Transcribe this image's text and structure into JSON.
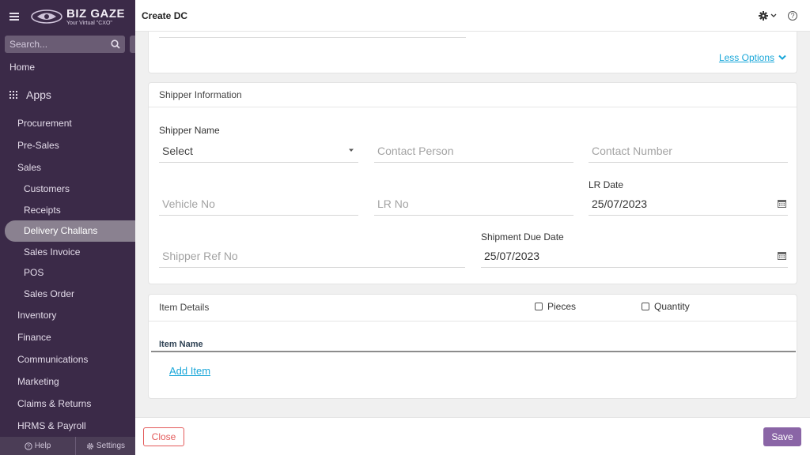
{
  "sidebar": {
    "logo": {
      "name": "BIZ GAZE",
      "tagline": "Your Virtual \"CXO\""
    },
    "search": {
      "placeholder": "Search..."
    },
    "home": "Home",
    "apps": "Apps",
    "items": [
      {
        "label": "Procurement"
      },
      {
        "label": "Pre-Sales"
      },
      {
        "label": "Sales"
      },
      {
        "label": "Customers"
      },
      {
        "label": "Receipts"
      },
      {
        "label": "Delivery Challans"
      },
      {
        "label": "Sales Invoice"
      },
      {
        "label": "POS"
      },
      {
        "label": "Sales Order"
      },
      {
        "label": "Inventory"
      },
      {
        "label": "Finance"
      },
      {
        "label": "Communications"
      },
      {
        "label": "Marketing"
      },
      {
        "label": "Claims & Returns"
      },
      {
        "label": "HRMS & Payroll"
      }
    ],
    "bottom": {
      "help": "Help",
      "settings": "Settings"
    }
  },
  "header": {
    "title": "Create DC"
  },
  "options": {
    "less_label": "Less Options"
  },
  "shipper": {
    "section_title": "Shipper Information",
    "shipper_name_label": "Shipper Name",
    "shipper_name_value": "Select",
    "contact_person_placeholder": "Contact Person",
    "contact_number_placeholder": "Contact Number",
    "vehicle_no_placeholder": "Vehicle No",
    "lr_no_placeholder": "LR No",
    "lr_date_label": "LR Date",
    "lr_date_value": "25/07/2023",
    "shipper_ref_placeholder": "Shipper Ref No",
    "shipment_due_label": "Shipment Due Date",
    "shipment_due_value": "25/07/2023"
  },
  "items": {
    "section_title": "Item Details",
    "pieces_label": "Pieces",
    "quantity_label": "Quantity",
    "column_item_name": "Item Name",
    "add_item": "Add Item"
  },
  "footer": {
    "close": "Close",
    "save": "Save"
  },
  "colors": {
    "sidebar_bg": "#3b2a48",
    "accent": "#8a65a6",
    "link": "#1aa7d9",
    "close": "#e35a5a"
  }
}
